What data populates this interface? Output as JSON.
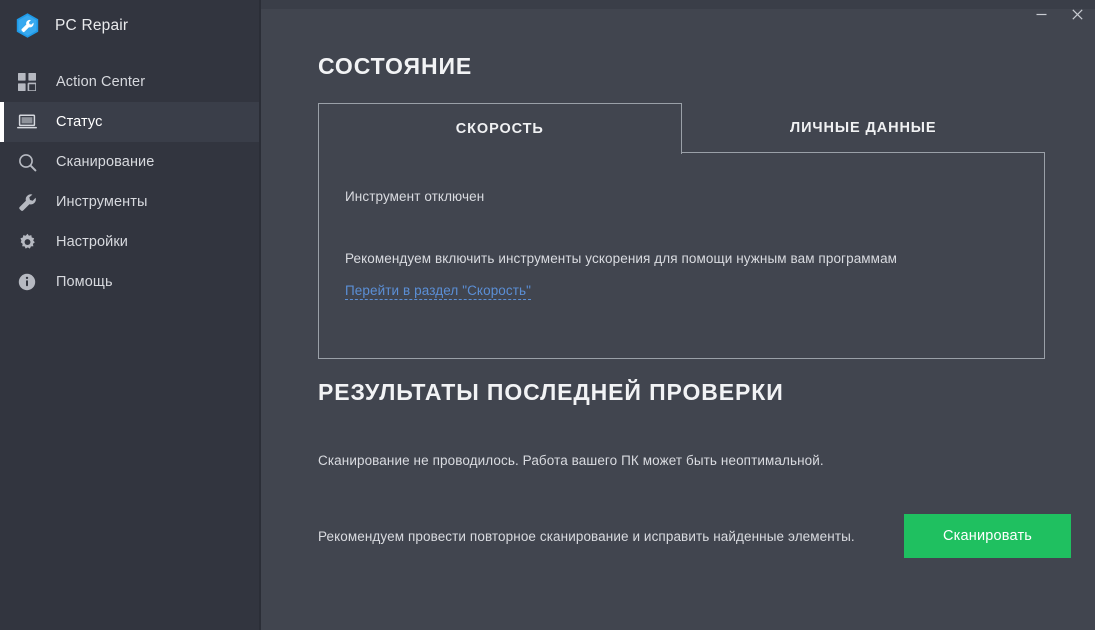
{
  "app": {
    "name": "PC Repair",
    "logo_icon": "wrench-hexagon-icon"
  },
  "window_controls": {
    "minimize_label": "—",
    "minimize_icon": "minimize-icon",
    "close_label": "×",
    "close_icon": "close-icon"
  },
  "sidebar": {
    "items": [
      {
        "label": "Action Center",
        "icon": "grid-icon",
        "selected": false
      },
      {
        "label": "Статус",
        "icon": "monitor-icon",
        "selected": true
      },
      {
        "label": "Сканирование",
        "icon": "search-icon",
        "selected": false
      },
      {
        "label": "Инструменты",
        "icon": "wrench-icon",
        "selected": false
      },
      {
        "label": "Настройки",
        "icon": "gear-icon",
        "selected": false
      },
      {
        "label": "Помощь",
        "icon": "info-icon",
        "selected": false
      }
    ]
  },
  "main": {
    "page_title": "СОСТОЯНИЕ",
    "tabs": [
      {
        "label": "СКОРОСТЬ",
        "active": true
      },
      {
        "label": "ЛИЧНЫЕ ДАННЫЕ",
        "active": false
      }
    ],
    "panel": {
      "status": "Инструмент отключен",
      "recommendation": "Рекомендуем включить инструменты ускорения для помощи нужным вам программам",
      "link": "Перейти в раздел \"Скорость\""
    },
    "results": {
      "title": "РЕЗУЛЬТАТЫ ПОСЛЕДНЕЙ ПРОВЕРКИ",
      "note": "Сканирование не проводилось. Работа вашего ПК может быть неоптимальной.",
      "scan_note": "Рекомендуем провести повторное сканирование и исправить найденные элементы.",
      "scan_button": "Сканировать"
    }
  },
  "colors": {
    "sidebar_bg": "#32353f",
    "main_bg": "#41454f",
    "selected_bg": "#3a3e49",
    "accent_bar": "#ffffff",
    "panel_border": "#9aa0a8",
    "link": "#5b8fd6",
    "scan_green": "#1fc060",
    "logo_blue": "#2196e8"
  }
}
